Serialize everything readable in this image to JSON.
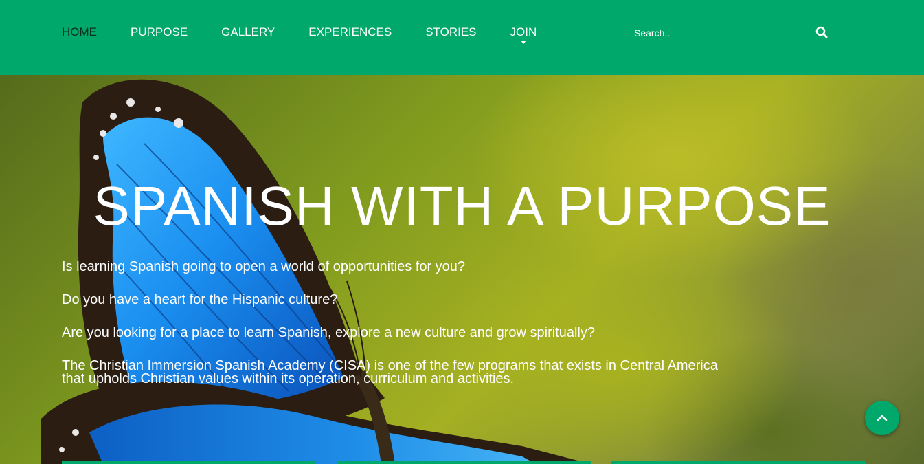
{
  "nav": {
    "items": [
      {
        "label": "HOME",
        "active": true
      },
      {
        "label": "PURPOSE"
      },
      {
        "label": "GALLERY"
      },
      {
        "label": "EXPERIENCES"
      },
      {
        "label": "STORIES"
      },
      {
        "label": "JOIN",
        "has_dropdown": true
      }
    ]
  },
  "search": {
    "placeholder": "Search..",
    "icon": "search-icon"
  },
  "hero": {
    "title": "SPANISH WITH A PURPOSE",
    "paragraphs": [
      "Is learning Spanish going to open a world of opportunities for you?",
      "Do you have a heart for the Hispanic culture?",
      "Are you looking for a place to learn Spanish, explore a new culture and grow spiritually?",
      "The Christian Immersion Spanish Academy (CISA) is one of the few programs that exists in Central America that upholds Christian values within its operation, curriculum and activities."
    ]
  },
  "scroll_top": {
    "icon": "chevron-up-icon"
  },
  "colors": {
    "brand": "#00a86b",
    "nav_active": "#0d2f22",
    "text": "#ffffff"
  }
}
